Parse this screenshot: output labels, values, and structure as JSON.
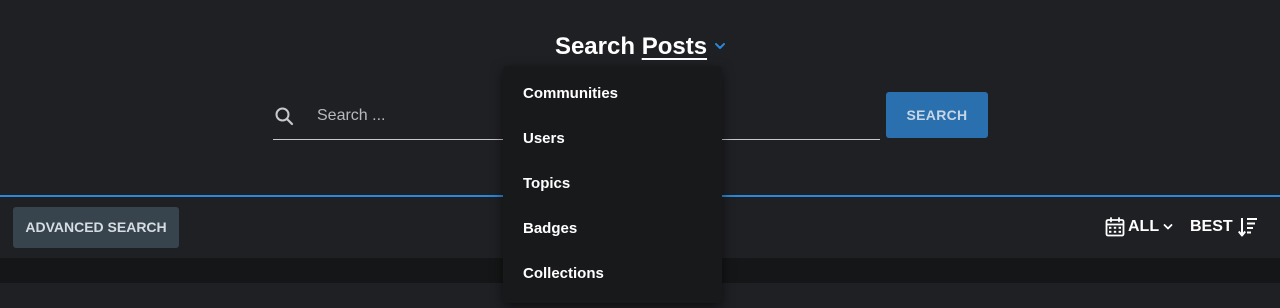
{
  "heading": {
    "prefix": "Search",
    "type_label": "Posts",
    "chevron_icon": "chevron-down-icon",
    "accent_color": "#2b87d8"
  },
  "search": {
    "icon": "search-icon",
    "placeholder": "Search ...",
    "value": "",
    "button_label": "SEARCH",
    "button_color": "#2a6fae"
  },
  "dropdown": {
    "items": [
      {
        "label": "Communities"
      },
      {
        "label": "Users"
      },
      {
        "label": "Topics"
      },
      {
        "label": "Badges"
      },
      {
        "label": "Collections"
      }
    ]
  },
  "toolbar": {
    "advanced_label": "ADVANCED SEARCH",
    "time_filter": {
      "icon": "calendar-icon",
      "label": "ALL",
      "chevron_icon": "chevron-down-icon"
    },
    "sort": {
      "label": "BEST",
      "icon": "sort-descending-icon"
    }
  },
  "colors": {
    "background": "#1f2024",
    "menu_background": "#18191b",
    "advanced_button": "#37444d"
  }
}
